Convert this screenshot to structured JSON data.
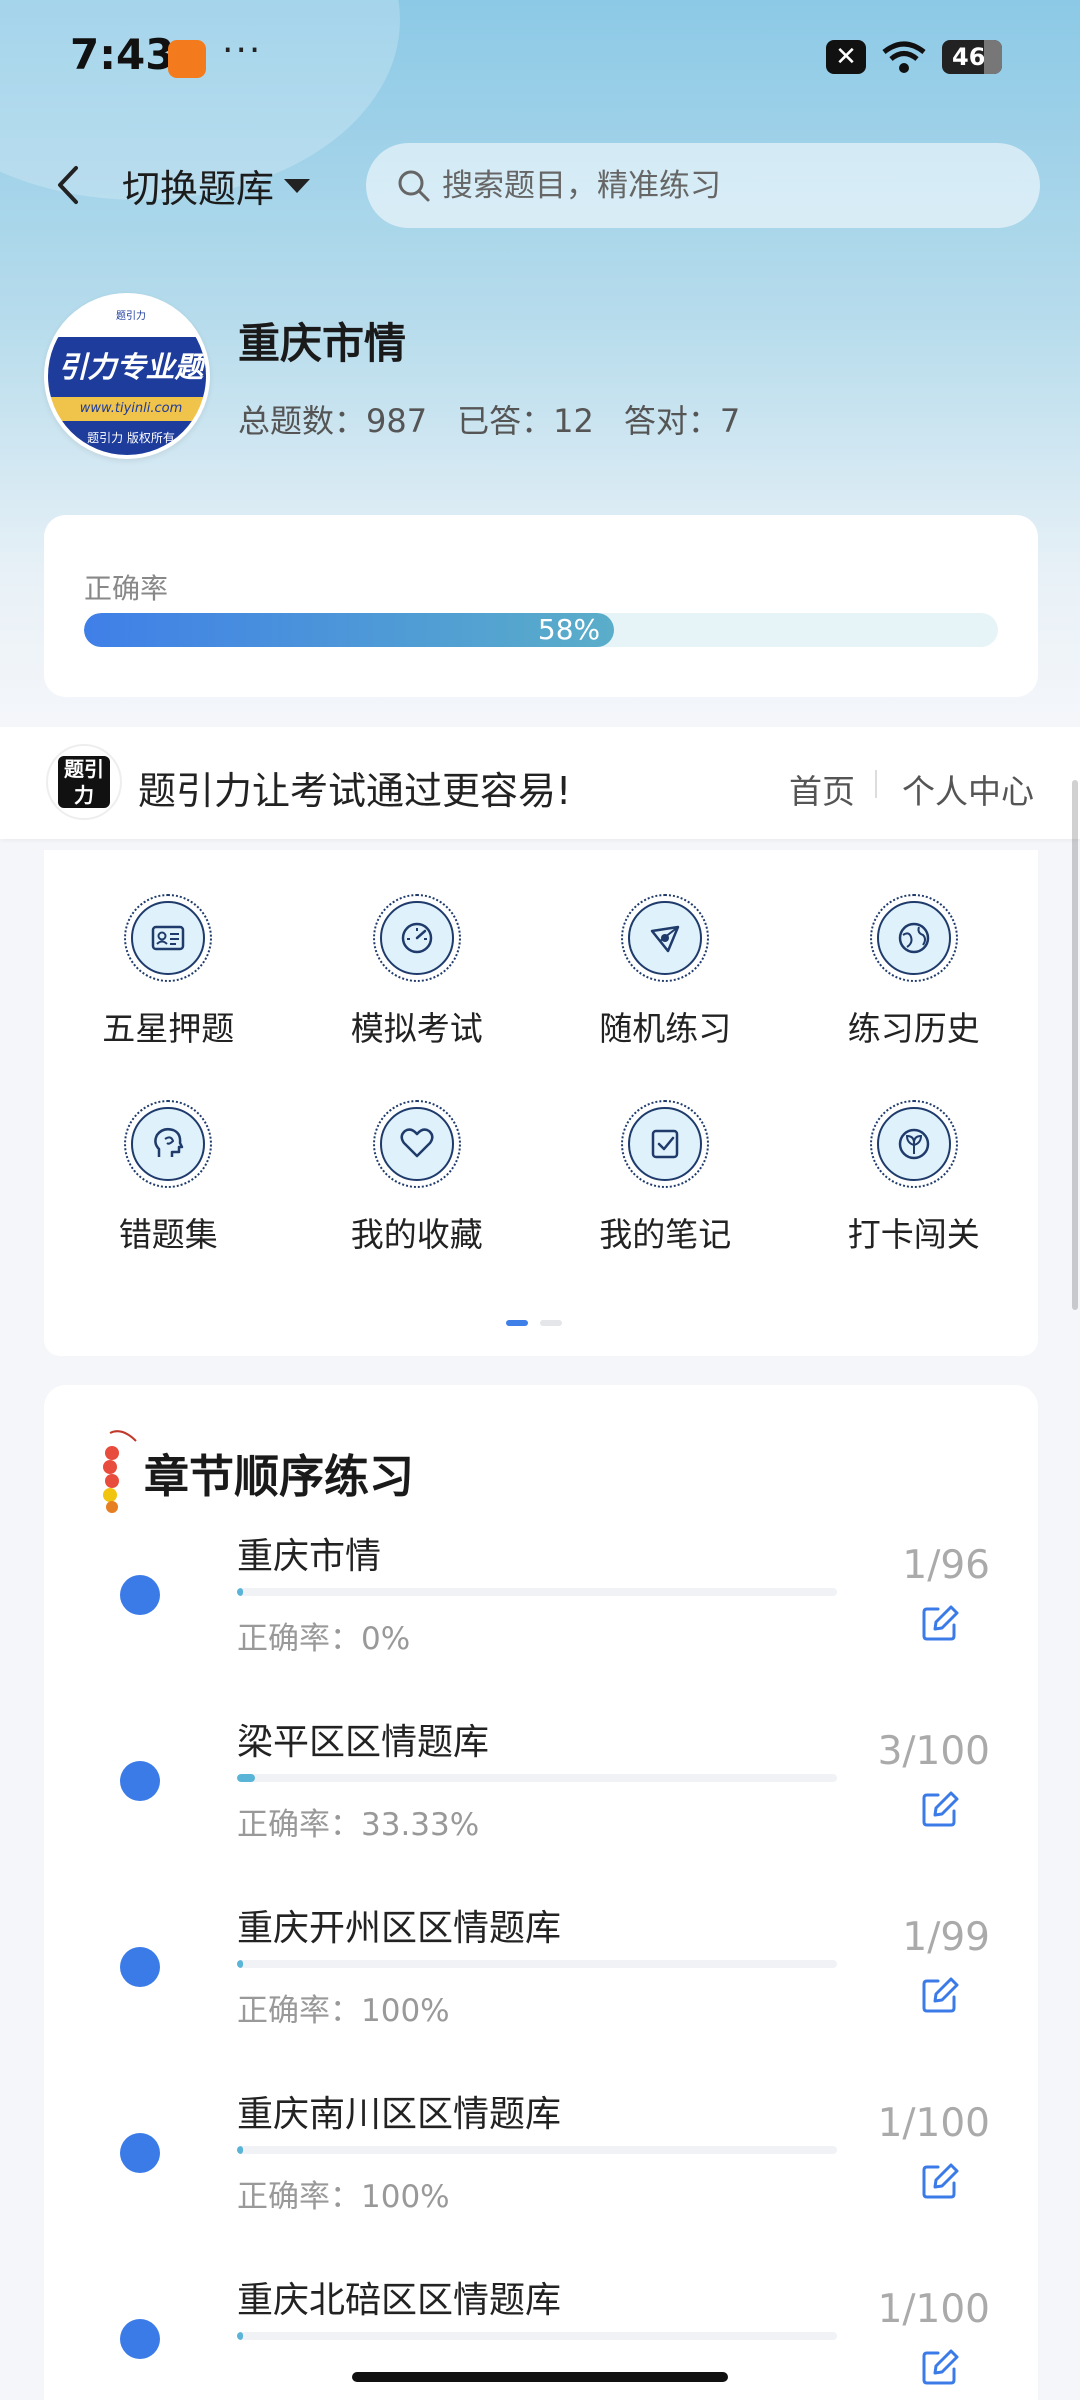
{
  "status_bar": {
    "time": "7:43",
    "more": "···",
    "battery": "46"
  },
  "nav": {
    "switch_label": "切换题库",
    "search_placeholder": "搜索题目，精准练习"
  },
  "book": {
    "title": "重庆市情",
    "total_label": "总题数：987",
    "answered_label": "已答：12",
    "correct_label": "答对：7",
    "avatar_text": "引力专业题",
    "avatar_url": "www.tiyinli.com",
    "avatar_copyright": "题引力 版权所有",
    "avatar_top": "题引力"
  },
  "accuracy": {
    "label": "正确率",
    "value_text": "58%",
    "value": 0.58
  },
  "banner": {
    "logo_text": "题引力",
    "slogan": "题引力让考试通过更容易!",
    "link_home": "首页",
    "link_profile": "个人中心"
  },
  "features": [
    {
      "label": "五星押题",
      "icon": "id-card-icon"
    },
    {
      "label": "模拟考试",
      "icon": "gauge-icon"
    },
    {
      "label": "随机练习",
      "icon": "network-icon"
    },
    {
      "label": "练习历史",
      "icon": "globe-icon"
    },
    {
      "label": "错题集",
      "icon": "head-icon"
    },
    {
      "label": "我的收藏",
      "icon": "heart-icon"
    },
    {
      "label": "我的笔记",
      "icon": "note-check-icon"
    },
    {
      "label": "打卡闯关",
      "icon": "leaf-icon"
    }
  ],
  "chapters": {
    "title": "章节顺序练习",
    "items": [
      {
        "name": "重庆市情",
        "accuracy": "正确率：0%",
        "count": "1/96",
        "progress": 0.0104
      },
      {
        "name": "梁平区区情题库",
        "accuracy": "正确率：33.33%",
        "count": "3/100",
        "progress": 0.03
      },
      {
        "name": "重庆开州区区情题库",
        "accuracy": "正确率：100%",
        "count": "1/99",
        "progress": 0.0101
      },
      {
        "name": "重庆南川区区情题库",
        "accuracy": "正确率：100%",
        "count": "1/100",
        "progress": 0.01
      },
      {
        "name": "重庆北碚区区情题库",
        "accuracy": "",
        "count": "1/100",
        "progress": 0.01
      }
    ]
  },
  "colors": {
    "accent": "#3b7be8",
    "teal": "#5ab4d8",
    "header_top": "#8cc9e6"
  }
}
